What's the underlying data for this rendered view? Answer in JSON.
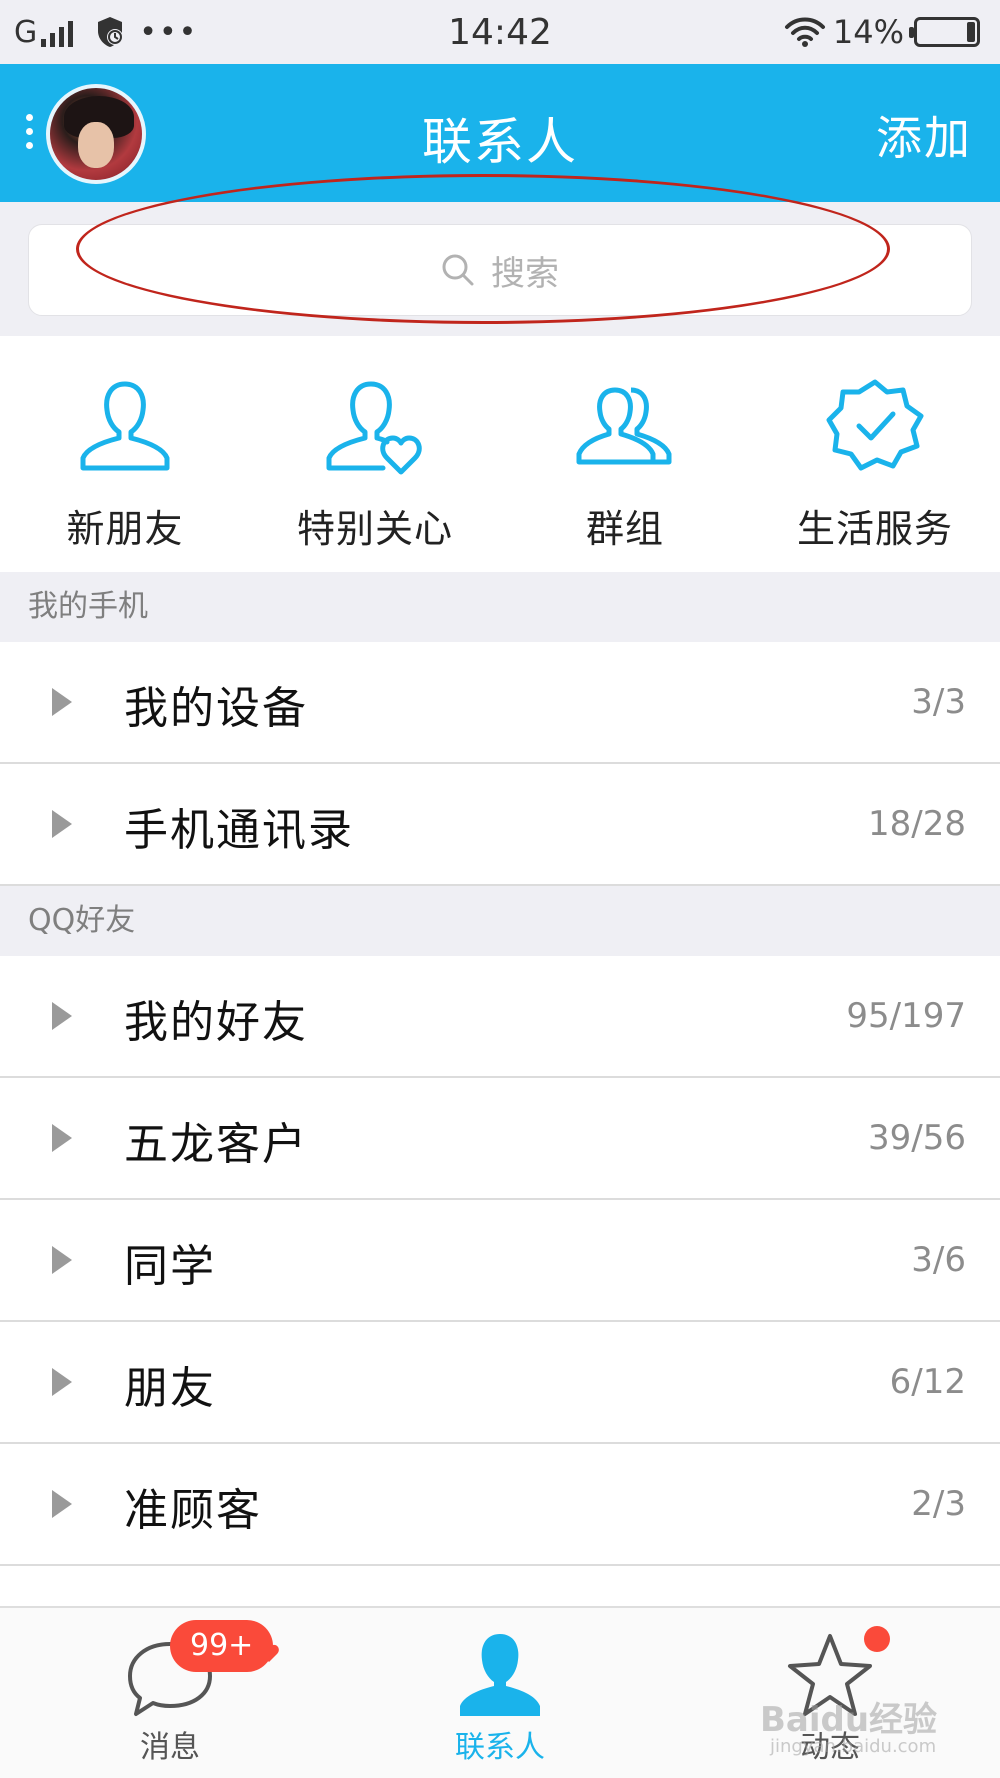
{
  "status_bar": {
    "carrier": "G",
    "dots": "•••",
    "time": "14:42",
    "battery_percent": "14%",
    "battery_level": 0.14
  },
  "header": {
    "title": "联系人",
    "add_label": "添加"
  },
  "search": {
    "placeholder": "搜索"
  },
  "quick_entries": [
    {
      "label": "新朋友",
      "icon": "person-icon"
    },
    {
      "label": "特别关心",
      "icon": "person-heart-icon"
    },
    {
      "label": "群组",
      "icon": "group-icon"
    },
    {
      "label": "生活服务",
      "icon": "badge-check-icon"
    }
  ],
  "sections": [
    {
      "title": "我的手机",
      "groups": [
        {
          "name": "我的设备",
          "count": "3/3"
        },
        {
          "name": "手机通讯录",
          "count": "18/28"
        }
      ]
    },
    {
      "title": "QQ好友",
      "groups": [
        {
          "name": "我的好友",
          "count": "95/197"
        },
        {
          "name": "五龙客户",
          "count": "39/56"
        },
        {
          "name": "同学",
          "count": "3/6"
        },
        {
          "name": "朋友",
          "count": "6/12"
        },
        {
          "name": "准顾客",
          "count": "2/3"
        }
      ]
    }
  ],
  "tabbar": {
    "tabs": [
      {
        "label": "消息",
        "icon": "chat-bubble-icon"
      },
      {
        "label": "联系人",
        "icon": "contact-person-icon"
      },
      {
        "label": "动态",
        "icon": "star-icon"
      }
    ],
    "badge": "99+",
    "watermark": "Baidu经验",
    "watermark_sub": "jingyan.baidu.com"
  },
  "colors": {
    "header_blue": "#1ab3eb",
    "icon_blue": "#1ab3eb",
    "badge_red": "#fa4a3a",
    "annotation_red": "#c0251c",
    "section_bg": "#efeff4"
  }
}
